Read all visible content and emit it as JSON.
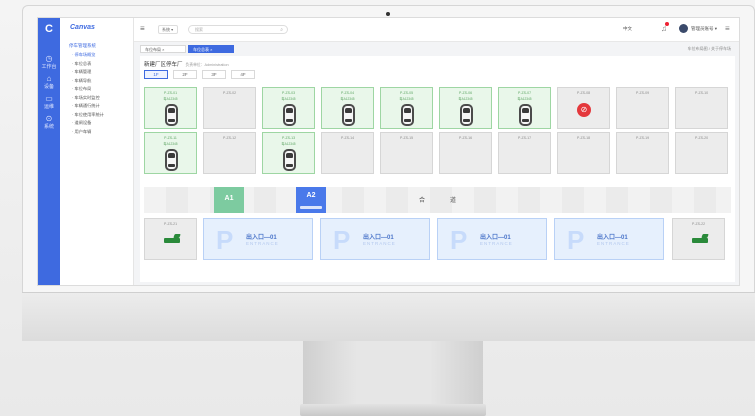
{
  "app": {
    "brand": "C",
    "brand_name": "Canvas"
  },
  "rail": [
    {
      "label": "工作台",
      "icon": "dashboard-icon"
    },
    {
      "label": "设备",
      "icon": "device-icon"
    },
    {
      "label": "运维",
      "icon": "ops-icon"
    },
    {
      "label": "系统",
      "icon": "settings-icon"
    }
  ],
  "menu": {
    "group": "停车管理系统",
    "items": [
      {
        "label": "· 停车场概览",
        "active": true
      },
      {
        "label": "· 车位总表",
        "active": false
      },
      {
        "label": "· 车辆管理",
        "active": false
      },
      {
        "label": "· 车辆导航",
        "active": false
      },
      {
        "label": "· 车位布局",
        "active": false
      },
      {
        "label": "· 车场实时监控",
        "active": false
      },
      {
        "label": "· 车辆通行统计",
        "active": false
      },
      {
        "label": "· 车位使用率统计",
        "active": false
      },
      {
        "label": "· 道闸设备",
        "active": false
      },
      {
        "label": "· 用户车辆",
        "active": false
      }
    ]
  },
  "topbar": {
    "scope": "系统 ▾",
    "search_placeholder": "搜索",
    "lang": "中文",
    "user": "管理员账号 ▾"
  },
  "tabs": [
    {
      "label": "车位布局 ×",
      "active": false
    },
    {
      "label": "车位总表 ×",
      "active": true
    }
  ],
  "tabs_right": "车位布局图 / 关于停车场",
  "panel": {
    "title": "新建厂区停车厂",
    "subtitle": "负责单位：Administration",
    "floors": [
      "1F",
      "2F",
      "3F",
      "4F"
    ],
    "active_floor": "1F"
  },
  "spots_row1": [
    {
      "id": "P-ZS-01",
      "plate": "粤A12345",
      "status": "occupied"
    },
    {
      "id": "P-ZS-02",
      "plate": "",
      "status": "empty"
    },
    {
      "id": "P-ZS-03",
      "plate": "粤A12345",
      "status": "occupied"
    },
    {
      "id": "P-ZS-04",
      "plate": "粤A12345",
      "status": "occupied"
    },
    {
      "id": "P-ZS-05",
      "plate": "粤A12345",
      "status": "occupied"
    },
    {
      "id": "P-ZS-06",
      "plate": "粤A12345",
      "status": "occupied"
    },
    {
      "id": "P-ZS-07",
      "plate": "粤A12345",
      "status": "occupied"
    },
    {
      "id": "P-ZS-08",
      "plate": "",
      "status": "alarm"
    },
    {
      "id": "P-ZS-09",
      "plate": "",
      "status": "empty"
    },
    {
      "id": "P-ZS-10",
      "plate": "",
      "status": "empty"
    }
  ],
  "spots_row2": [
    {
      "id": "P-ZS-11",
      "plate": "粤A12345",
      "status": "occupied"
    },
    {
      "id": "P-ZS-12",
      "plate": "",
      "status": "empty"
    },
    {
      "id": "P-ZS-13",
      "plate": "粤A12345",
      "status": "occupied"
    },
    {
      "id": "P-ZS-14",
      "plate": "",
      "status": "empty"
    },
    {
      "id": "P-ZS-15",
      "plate": "",
      "status": "empty"
    },
    {
      "id": "P-ZS-16",
      "plate": "",
      "status": "empty"
    },
    {
      "id": "P-ZS-17",
      "plate": "",
      "status": "empty"
    },
    {
      "id": "P-ZS-18",
      "plate": "",
      "status": "empty"
    },
    {
      "id": "P-ZS-19",
      "plate": "",
      "status": "empty"
    },
    {
      "id": "P-ZS-20",
      "plate": "",
      "status": "empty"
    }
  ],
  "aisle": {
    "zone_a1": "A1",
    "zone_a2": "A2",
    "label_left": "合",
    "label_right": "道"
  },
  "gates": [
    {
      "id": "P-ZS-21"
    },
    {
      "id": "P-ZS-22"
    }
  ],
  "entrances": [
    {
      "name": "出入口—01",
      "en": "ENTRANCE"
    },
    {
      "name": "出入口—01",
      "en": "ENTRANCE"
    },
    {
      "name": "出入口—01",
      "en": "ENTRANCE"
    },
    {
      "name": "出入口—01",
      "en": "ENTRANCE"
    }
  ],
  "colors": {
    "accent": "#3e6ae0",
    "occupied": "#e9f7ea",
    "alarm": "#e4383c",
    "zone_a1": "#7dcba0"
  }
}
